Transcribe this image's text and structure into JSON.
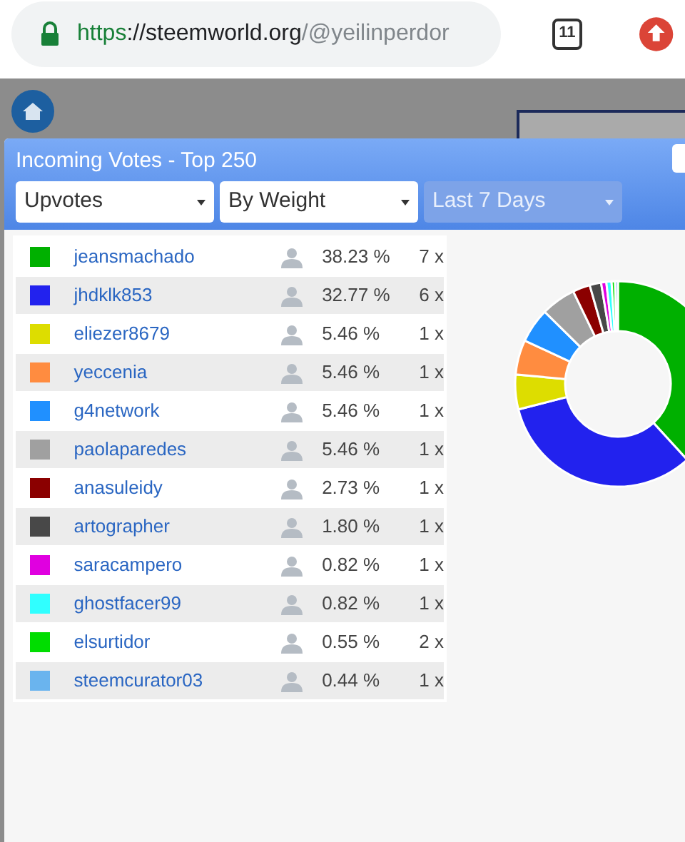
{
  "browser": {
    "url_scheme": "https",
    "url_host": "://steemworld.org",
    "url_path": "/@yeilinperdor",
    "tab_count": "11"
  },
  "dialog": {
    "title": "Incoming Votes - Top 250",
    "filters": [
      {
        "value": "Upvotes",
        "disabled": false
      },
      {
        "value": "By Weight",
        "disabled": false
      },
      {
        "value": "Last 7 Days",
        "disabled": true
      }
    ],
    "rows": [
      {
        "color": "#00b000",
        "name": "jeansmachado",
        "share": "38.23 %",
        "count": "7 x"
      },
      {
        "color": "#2222ee",
        "name": "jhdklk853",
        "share": "32.77 %",
        "count": "6 x"
      },
      {
        "color": "#dddd00",
        "name": "eliezer8679",
        "share": "5.46 %",
        "count": "1 x"
      },
      {
        "color": "#ff8c40",
        "name": "yeccenia",
        "share": "5.46 %",
        "count": "1 x"
      },
      {
        "color": "#2090ff",
        "name": "g4network",
        "share": "5.46 %",
        "count": "1 x"
      },
      {
        "color": "#a0a0a0",
        "name": "paolaparedes",
        "share": "5.46 %",
        "count": "1 x"
      },
      {
        "color": "#8b0000",
        "name": "anasuleidy",
        "share": "2.73 %",
        "count": "1 x"
      },
      {
        "color": "#484848",
        "name": "artographer",
        "share": "1.80 %",
        "count": "1 x"
      },
      {
        "color": "#e000e0",
        "name": "saracampero",
        "share": "0.82 %",
        "count": "1 x"
      },
      {
        "color": "#30ffff",
        "name": "ghostfacer99",
        "share": "0.82 %",
        "count": "1 x"
      },
      {
        "color": "#00dd00",
        "name": "elsurtidor",
        "share": "0.55 %",
        "count": "2 x"
      },
      {
        "color": "#6ab4ee",
        "name": "steemcurator03",
        "share": "0.44 %",
        "count": "1 x"
      }
    ]
  }
}
